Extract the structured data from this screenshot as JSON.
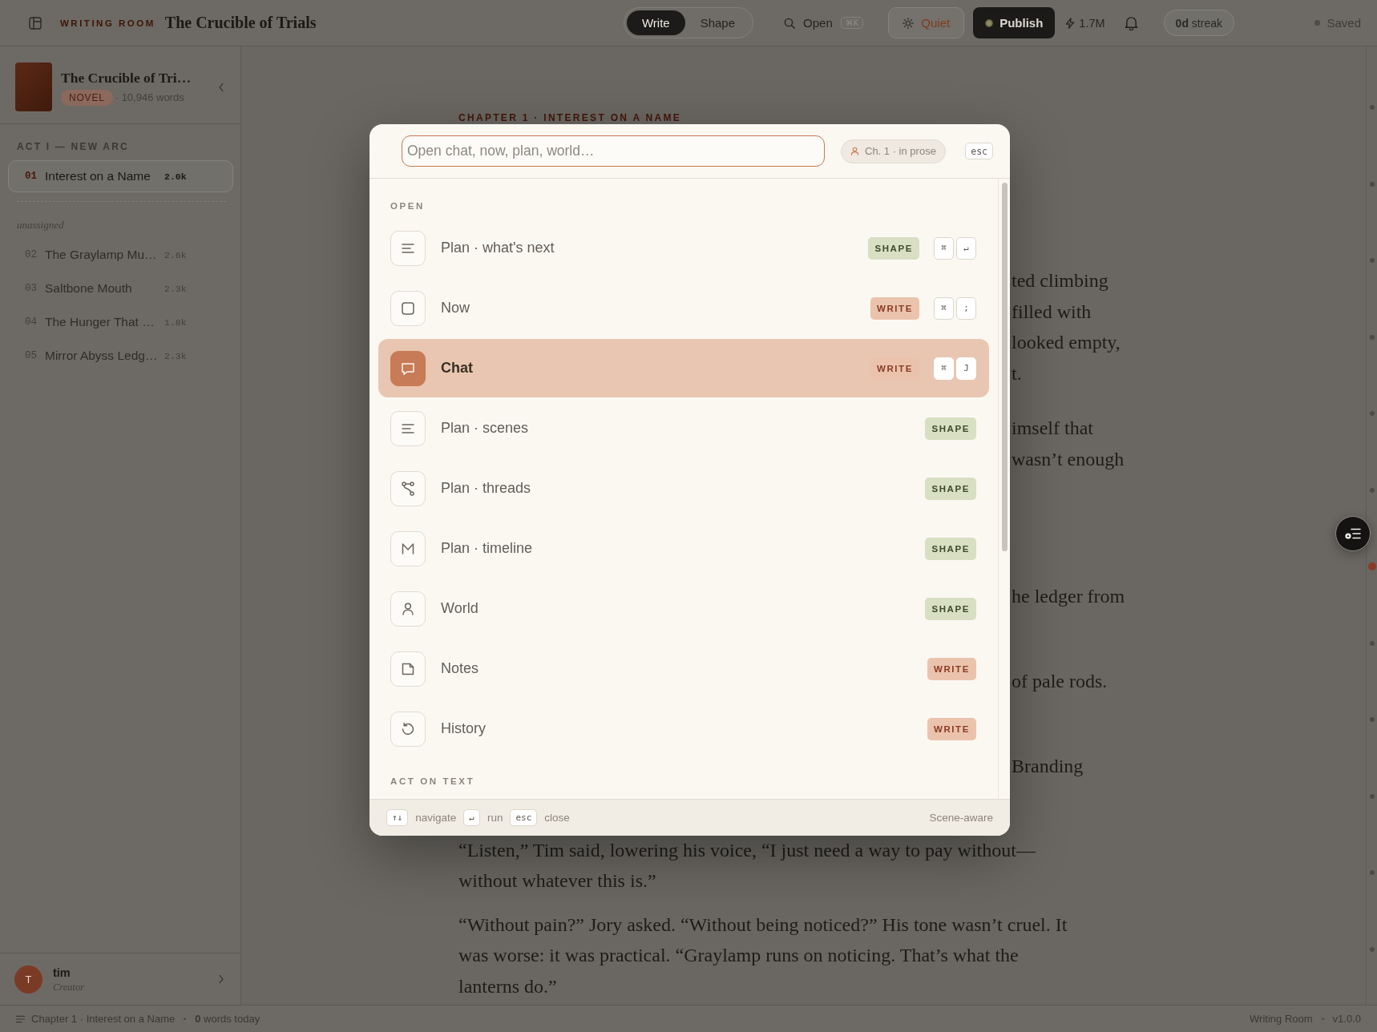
{
  "topbar": {
    "brand": "WRITING ROOM",
    "title": "The Crucible of Trials",
    "modes": [
      {
        "label": "Write",
        "selected": true
      },
      {
        "label": "Shape",
        "selected": false
      }
    ],
    "open": {
      "label": "Open",
      "shortcut": "⌘K"
    },
    "quiet": {
      "label": "Quiet"
    },
    "publish": {
      "label": "Publish"
    },
    "reach": "1.7M",
    "streak": "**0d** streak",
    "save_status": "Saved"
  },
  "sidebar": {
    "book": {
      "title": "The Crucible of Tri…",
      "genre": "NOVEL",
      "words": "· 10,946 words"
    },
    "acts": [
      {
        "label": "ACT I — NEW ARC",
        "chapters": [
          {
            "number": "01",
            "title": "Interest on a Name",
            "words": "2.0k",
            "selected": true
          }
        ]
      }
    ],
    "unassigned": {
      "label": "unassigned",
      "chapters": [
        {
          "number": "02",
          "title": "The Graylamp Mu…",
          "words": "2.6k",
          "selected": false
        },
        {
          "number": "03",
          "title": "Saltbone Mouth",
          "words": "2.3k",
          "selected": false
        },
        {
          "number": "04",
          "title": "The Hunger That …",
          "words": "1.8k",
          "selected": false
        },
        {
          "number": "05",
          "title": "Mirror Abyss Ledg…",
          "words": "2.3k",
          "selected": false
        }
      ]
    },
    "user": {
      "initial": "T",
      "name": "tim",
      "role": "Creator"
    }
  },
  "manuscript": {
    "heading": "CHAPTER 1 · INTEREST ON A NAME",
    "beside_dialog": [
      {
        "lines": [
          "ted climbing",
          "filled with",
          "looked empty,",
          "t."
        ]
      },
      {
        "lines": [
          "imself that",
          "wasn’t enough"
        ]
      },
      {
        "lines": [
          "he ledger from"
        ]
      },
      {
        "lines": [
          "of pale rods."
        ]
      },
      {
        "lines": [
          "Branding"
        ]
      }
    ],
    "paragraphs": [
      {
        "lines": [
          "“Listen,” Tim said, lowering his voice, “I just need a way to pay without—",
          "without whatever this is.”"
        ]
      },
      {
        "lines": [
          "“Without pain?” Jory asked. “Without being noticed?” His tone wasn’t cruel. It",
          "was worse: it was practical. “Graylamp runs on noticing. That’s what the",
          "lanterns do.”"
        ]
      }
    ]
  },
  "scene_rail": [
    {
      "current": false
    },
    {
      "current": false
    },
    {
      "current": false
    },
    {
      "current": false
    },
    {
      "current": false
    },
    {
      "current": false
    },
    {
      "current": true
    },
    {
      "current": false
    },
    {
      "current": false
    },
    {
      "current": false
    },
    {
      "current": false
    },
    {
      "current": false
    }
  ],
  "palette": {
    "search": {
      "placeholder": "Open chat, now, plan, world…"
    },
    "context": "Ch. 1 · in prose",
    "close_key": "esc",
    "sections": [
      {
        "label": "OPEN",
        "items": [
          {
            "kind": "outline",
            "label": "Plan · what's next",
            "tag": {
              "kind": "shape",
              "text": "SHAPE"
            },
            "keys": [
              "⌘",
              "↵"
            ],
            "selected": false
          },
          {
            "kind": "now",
            "label": "Now",
            "tag": {
              "kind": "write",
              "text": "WRITE"
            },
            "keys": [
              "⌘",
              ";"
            ],
            "selected": false
          },
          {
            "kind": "chat",
            "label": "Chat",
            "tag": {
              "kind": "write",
              "text": "WRITE"
            },
            "keys": [
              "⌘",
              "J"
            ],
            "selected": true
          },
          {
            "kind": "outline",
            "label": "Plan · scenes",
            "tag": {
              "kind": "shape",
              "text": "SHAPE"
            },
            "selected": false
          },
          {
            "kind": "threads",
            "label": "Plan · threads",
            "tag": {
              "kind": "shape",
              "text": "SHAPE"
            },
            "selected": false
          },
          {
            "kind": "timeline",
            "label": "Plan · timeline",
            "tag": {
              "kind": "shape",
              "text": "SHAPE"
            },
            "selected": false
          },
          {
            "kind": "world",
            "label": "World",
            "tag": {
              "kind": "shape",
              "text": "SHAPE"
            },
            "selected": false
          },
          {
            "kind": "notes",
            "label": "Notes",
            "tag": {
              "kind": "write",
              "text": "WRITE"
            },
            "selected": false
          },
          {
            "kind": "history",
            "label": "History",
            "tag": {
              "kind": "write",
              "text": "WRITE"
            },
            "selected": false
          }
        ]
      },
      {
        "label": "ACT ON TEXT"
      }
    ],
    "footer": {
      "hints": [
        {
          "key": "↑↓",
          "label": "navigate"
        },
        {
          "key": "↵",
          "label": "run"
        },
        {
          "key": "esc",
          "label": "close"
        }
      ],
      "note": "Scene-aware"
    }
  },
  "status_bar": {
    "chapter": "Chapter 1 · Interest on a Name",
    "today": "**0** words today",
    "app": "Writing Room",
    "version": "v1.0.0"
  }
}
